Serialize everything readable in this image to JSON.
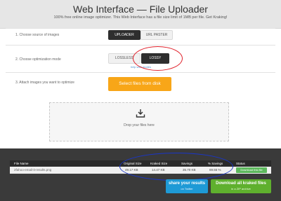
{
  "header": {
    "title": "Web Interface — File Uploader",
    "subtitle": "100% free online image optimizer. This Web Interface has a file size limit of 1MB per file. Get Kraking!"
  },
  "steps": {
    "source_label": "1. Choose source of images",
    "uploader_label": "UPLOADER",
    "url_paster_label": "URL PASTER",
    "mode_label": "2. Choose optimization mode",
    "lossless_label": "LOSSLESS",
    "lossy_label": "LOSSY",
    "help_link": "help with modes",
    "attach_label": "3. Attach images you want to optimize",
    "select_files_label": "Select files from disk",
    "drop_text": "Drop your files here"
  },
  "table": {
    "columns": [
      "File Name",
      "Original Size",
      "Kraked Size",
      "Savings",
      "% Savings",
      "Status"
    ],
    "rows": [
      {
        "file_name": "2fahoo-email-it-results.png",
        "original_size": "49.17 KB",
        "kraked_size": "14.47 KB",
        "savings": "35.70 KB",
        "percent_savings": "69.55 %",
        "status": "Download this file"
      }
    ]
  },
  "actions": {
    "share_main": "share your results",
    "share_sub": "on Twitter",
    "download_main": "Download all kraked files",
    "download_sub": "in a ZIP archive"
  },
  "colors": {
    "accent_orange": "#f8a618",
    "dark_button": "#2e2e2e",
    "status_green": "#5cb85c",
    "share_blue": "#1e9ad6",
    "download_green": "#5fb02e",
    "annotation_red": "#e0202a",
    "annotation_blue": "#1a36c8"
  }
}
